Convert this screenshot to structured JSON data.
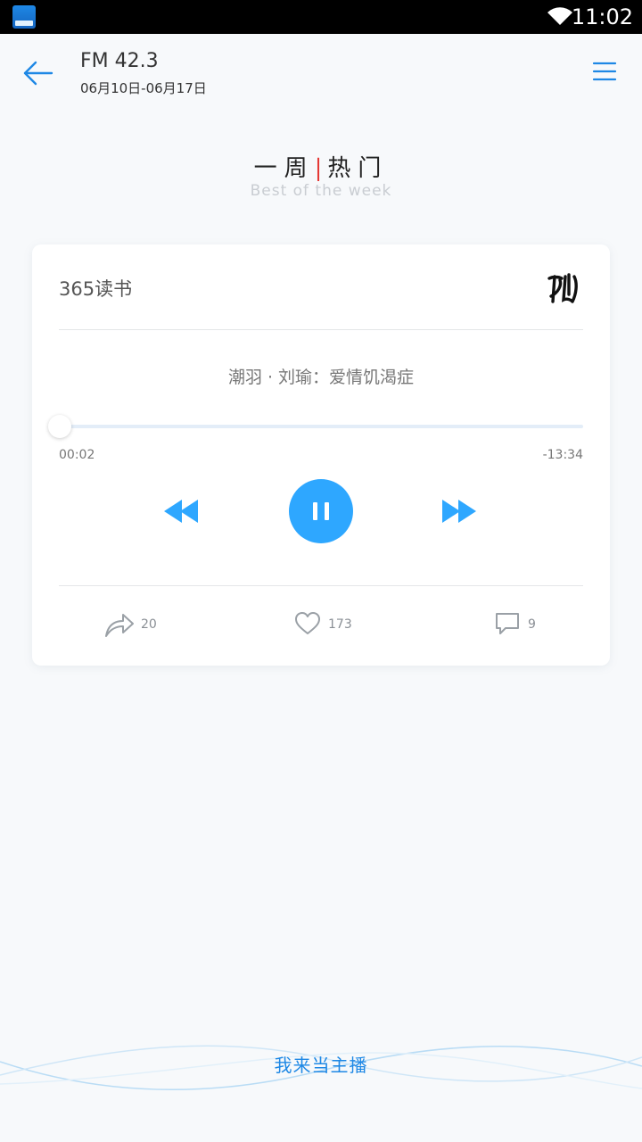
{
  "status_bar": {
    "time": "11:02",
    "app_icon": "app-notification-icon",
    "wifi_icon": "wifi-icon"
  },
  "header": {
    "title": "FM 42.3",
    "subtitle": "06月10日-06月17日",
    "back_icon": "arrow-left-icon",
    "menu_icon": "hamburger-menu-icon"
  },
  "section": {
    "title_left": "一周",
    "separator": "|",
    "title_right": "热门",
    "subtitle": "Best of the week"
  },
  "player": {
    "program_name": "365读书",
    "track_title": "潮羽 · 刘瑜：爱情饥渴症",
    "elapsed": "00:02",
    "remaining": "-13:34",
    "progress_fraction": 0.01,
    "accent_color": "#2ea7ff"
  },
  "actions": {
    "share_count": "20",
    "like_count": "173",
    "comment_count": "9"
  },
  "footer": {
    "host_label": "我来当主播"
  }
}
